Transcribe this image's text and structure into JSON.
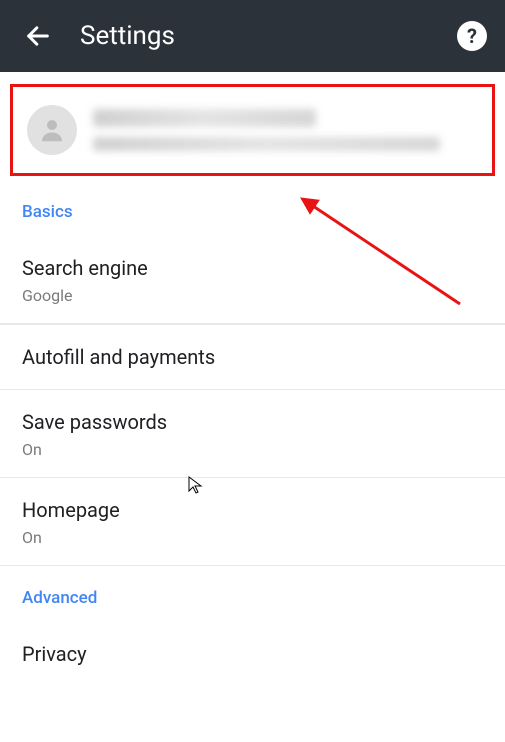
{
  "header": {
    "title": "Settings",
    "back_icon": "arrow-back",
    "help_icon": "?"
  },
  "account": {
    "name_redacted": true,
    "email_redacted": true
  },
  "sections": {
    "basics": {
      "label": "Basics",
      "items": [
        {
          "title": "Search engine",
          "sub": "Google"
        },
        {
          "title": "Autofill and payments",
          "sub": ""
        },
        {
          "title": "Save passwords",
          "sub": "On"
        },
        {
          "title": "Homepage",
          "sub": "On"
        }
      ]
    },
    "advanced": {
      "label": "Advanced",
      "items": [
        {
          "title": "Privacy",
          "sub": ""
        }
      ]
    }
  },
  "annotation": {
    "highlight_color": "#e81414"
  }
}
